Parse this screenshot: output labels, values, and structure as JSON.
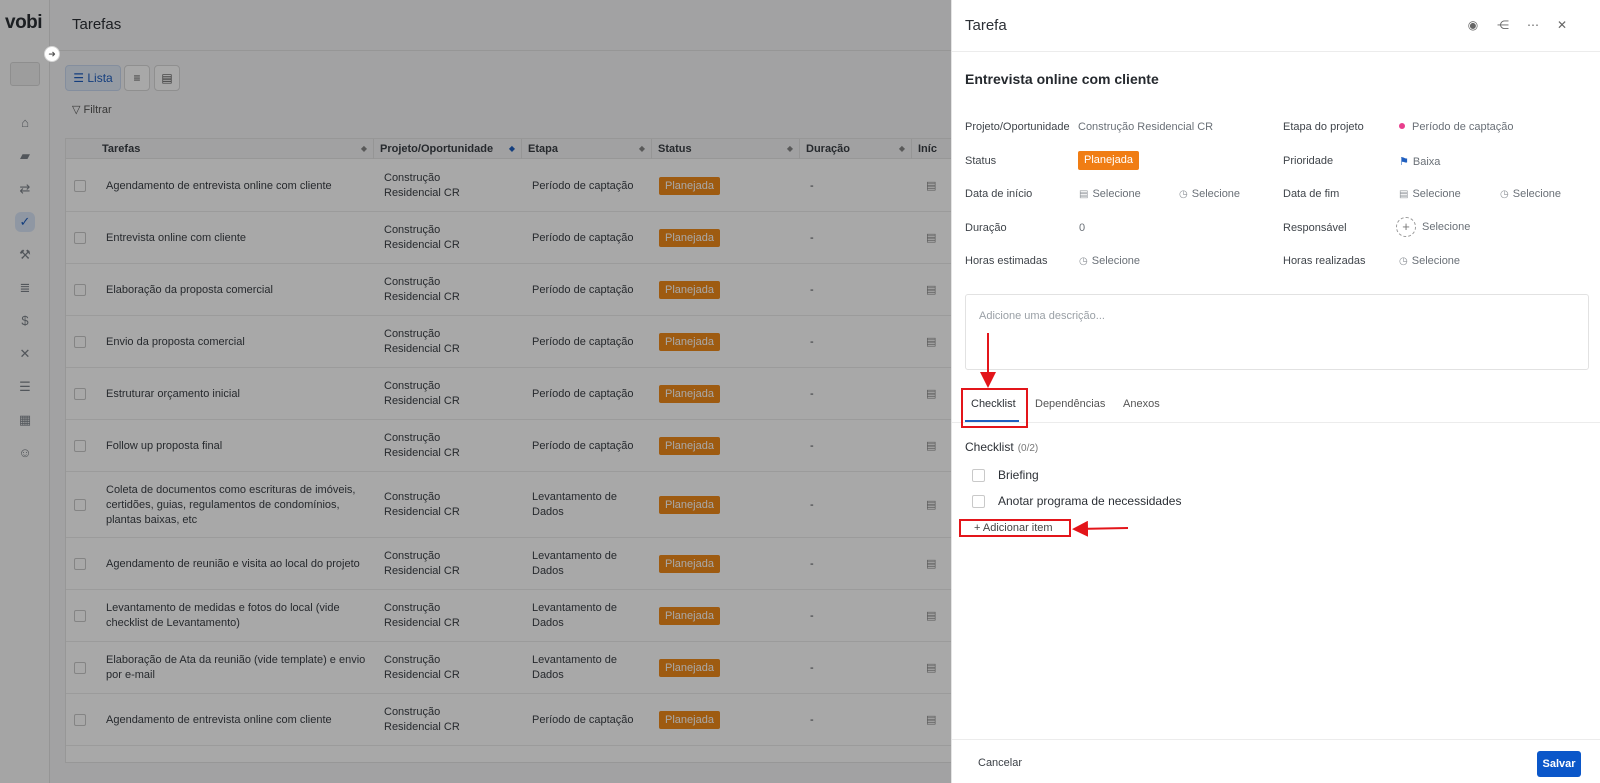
{
  "brand": "vobi",
  "page_title": "Tarefas",
  "views": {
    "list_label": "Lista",
    "list_icon": "list-icon",
    "gantt_icon": "gantt-icon",
    "calendar_icon": "calendar-icon"
  },
  "filter_label": "Filtrar",
  "nav_icons": [
    "home-icon",
    "folder-icon",
    "handshake-icon",
    "compass-icon",
    "worker-icon",
    "stack-icon",
    "dollar-icon",
    "tools-icon",
    "list-icon",
    "grid-icon",
    "people-icon"
  ],
  "table": {
    "headers": [
      "Tarefas",
      "Projeto/Oportunidade",
      "Etapa",
      "Status",
      "Duração",
      "Iníc"
    ],
    "rows": [
      {
        "task": "Agendamento de entrevista online com cliente",
        "project": "Construção\nResidencial CR",
        "stage": "Período de captação",
        "status": "Planejada",
        "duration": "-"
      },
      {
        "task": "Entrevista online com cliente",
        "project": "Construção\nResidencial CR",
        "stage": "Período de captação",
        "status": "Planejada",
        "duration": "-"
      },
      {
        "task": "Elaboração da proposta comercial",
        "project": "Construção\nResidencial CR",
        "stage": "Período de captação",
        "status": "Planejada",
        "duration": "-"
      },
      {
        "task": "Envio da proposta comercial",
        "project": "Construção\nResidencial CR",
        "stage": "Período de captação",
        "status": "Planejada",
        "duration": "-"
      },
      {
        "task": "Estruturar orçamento inicial",
        "project": "Construção\nResidencial CR",
        "stage": "Período de captação",
        "status": "Planejada",
        "duration": "-"
      },
      {
        "task": "Follow up proposta final",
        "project": "Construção\nResidencial CR",
        "stage": "Período de captação",
        "status": "Planejada",
        "duration": "-"
      },
      {
        "task": "Coleta de documentos como escrituras de imóveis,\ncertidões, guias, regulamentos de condomínios,\nplantas baixas, etc",
        "project": "Construção\nResidencial CR",
        "stage": "Levantamento de\nDados",
        "status": "Planejada",
        "duration": "-"
      },
      {
        "task": "Agendamento de reunião e visita ao local do projeto",
        "project": "Construção\nResidencial CR",
        "stage": "Levantamento de\nDados",
        "status": "Planejada",
        "duration": "-"
      },
      {
        "task": "Levantamento de medidas e fotos do local (vide\nchecklist de Levantamento)",
        "project": "Construção\nResidencial CR",
        "stage": "Levantamento de\nDados",
        "status": "Planejada",
        "duration": "-"
      },
      {
        "task": "Elaboração de Ata da reunião (vide template) e envio\npor e-mail",
        "project": "Construção\nResidencial CR",
        "stage": "Levantamento de\nDados",
        "status": "Planejada",
        "duration": "-"
      },
      {
        "task": "Agendamento de entrevista online com cliente",
        "project": "Construção\nResidencial CR",
        "stage": "Período de captação",
        "status": "Planejada",
        "duration": "-"
      }
    ]
  },
  "panel": {
    "title": "Tarefa",
    "header_icons": [
      "eye-icon",
      "share-icon",
      "more-icon",
      "close-icon"
    ],
    "task_name": "Entrevista online com cliente",
    "fields": {
      "project_label": "Projeto/Oportunidade",
      "project_value": "Construção Residencial CR",
      "stage_label": "Etapa do projeto",
      "stage_value": "Período de captação",
      "status_label": "Status",
      "status_value": "Planejada",
      "priority_label": "Prioridade",
      "priority_value": "Baixa",
      "start_label": "Data de início",
      "end_label": "Data de fim",
      "select": "Selecione",
      "duration_label": "Duração",
      "duration_value": "0",
      "responsible_label": "Responsável",
      "est_hours_label": "Horas estimadas",
      "real_hours_label": "Horas realizadas"
    },
    "description_placeholder": "Adicione uma descrição...",
    "tabs": [
      "Checklist",
      "Dependências",
      "Anexos"
    ],
    "checklist": {
      "title": "Checklist",
      "count": "(0/2)",
      "items": [
        "Briefing",
        "Anotar programa de necessidades"
      ],
      "add_label": "Adicionar item"
    },
    "cancel_label": "Cancelar",
    "save_label": "Salvar"
  },
  "colors": {
    "accent": "#0b57c9",
    "status_badge": "#f07d14",
    "annotation": "#e3151a",
    "stage_dot": "#e83e8c"
  }
}
